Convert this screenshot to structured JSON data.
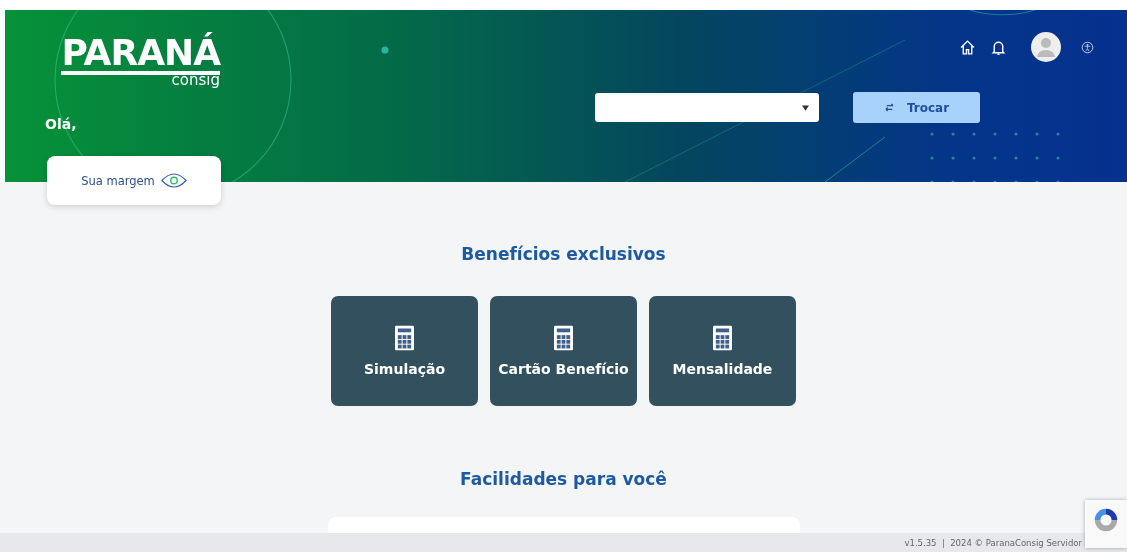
{
  "header": {
    "logo": {
      "main": "PARANÁ",
      "sub": "consig"
    },
    "greeting": "Olá,",
    "margin_card": {
      "label": "Sua margem"
    },
    "switch_button": {
      "label": "Trocar"
    }
  },
  "benefits": {
    "title": "Benefícios exclusivos",
    "items": [
      {
        "label": "Simulação"
      },
      {
        "label": "Cartão Benefício"
      },
      {
        "label": "Mensalidade"
      }
    ]
  },
  "facilities": {
    "title": "Facilidades para você"
  },
  "footer": {
    "text": "v1.5.35  |  2024 © ParanaConsig Servidor"
  }
}
